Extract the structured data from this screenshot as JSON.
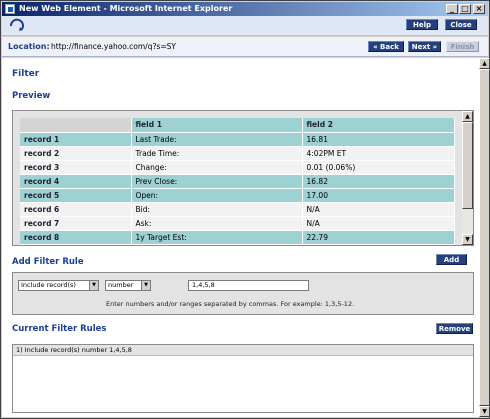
{
  "window": {
    "title": "New Web Element - Microsoft Internet Explorer",
    "controls": [
      "_",
      "□",
      "×"
    ]
  },
  "toolbar": {
    "help_label": "Help",
    "close_label": "Close"
  },
  "location": {
    "label": "Location:",
    "url": "http://finance.yahoo.com/q?s=SY",
    "back_label": "« Back",
    "next_label": "Next »",
    "finish_label": "Finish"
  },
  "page": {
    "title": "Filter",
    "preview": {
      "heading": "Preview",
      "columns": [
        "",
        "field 1",
        "field 2"
      ],
      "rows": [
        {
          "record": "record 1",
          "field1": "Last Trade:",
          "field2": "16.81",
          "highlighted": true
        },
        {
          "record": "record 2",
          "field1": "Trade Time:",
          "field2": "4:02PM ET",
          "highlighted": false
        },
        {
          "record": "record 3",
          "field1": "Change:",
          "field2": "0.01 (0.06%)",
          "highlighted": false
        },
        {
          "record": "record 4",
          "field1": "Prev Close:",
          "field2": "16.82",
          "highlighted": true
        },
        {
          "record": "record 5",
          "field1": "Open:",
          "field2": "17.00",
          "highlighted": true
        },
        {
          "record": "record 6",
          "field1": "Bid:",
          "field2": "N/A",
          "highlighted": false
        },
        {
          "record": "record 7",
          "field1": "Ask:",
          "field2": "N/A",
          "highlighted": false
        },
        {
          "record": "record 8",
          "field1": "1y Target Est:",
          "field2": "22.79",
          "highlighted": true
        }
      ]
    },
    "add_rule": {
      "heading": "Add Filter Rule",
      "add_label": "Add",
      "include_select": "Include record(s)",
      "type_select": "number",
      "value": "1,4,5,8",
      "hint": "Enter numbers and/or ranges separated by commas. For example: 1,3,5-12."
    },
    "current_rules": {
      "heading": "Current Filter Rules",
      "remove_label": "Remove",
      "rules": [
        "1) Include record(s) number 1,4,5,8"
      ]
    }
  },
  "colors": {
    "accent": "#1d3f8f",
    "highlight_row": "#9dd1d2",
    "button": "#26407e"
  }
}
